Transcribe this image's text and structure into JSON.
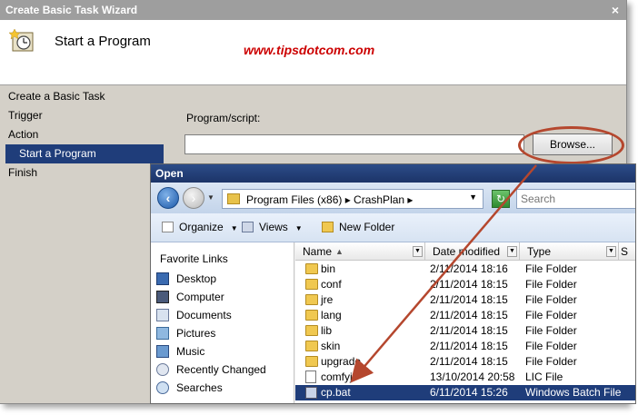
{
  "wizard": {
    "title": "Create Basic Task Wizard",
    "close": "×",
    "page_title": "Start a Program",
    "watermark": "www.tipsdotcom.com",
    "steps": [
      "Create a Basic Task",
      "Trigger",
      "Action",
      "Start a Program",
      "Finish"
    ],
    "active_step": "Start a Program",
    "program_label": "Program/script:",
    "program_value": "",
    "browse_label": "Browse..."
  },
  "open_dialog": {
    "title": "Open",
    "address": "Program Files (x86)  ▸  CrashPlan  ▸",
    "search_placeholder": "Search",
    "toolbar": {
      "organize": "Organize",
      "views": "Views",
      "new_folder": "New Folder"
    },
    "favorites_header": "Favorite Links",
    "favorites": [
      "Desktop",
      "Computer",
      "Documents",
      "Pictures",
      "Music",
      "Recently Changed",
      "Searches"
    ],
    "columns": {
      "name": "Name",
      "date": "Date modified",
      "type": "Type",
      "size": "S"
    },
    "files": [
      {
        "name": "bin",
        "date": "2/11/2014 18:16",
        "type": "File Folder",
        "icon": "folder-icon"
      },
      {
        "name": "conf",
        "date": "2/11/2014 18:15",
        "type": "File Folder",
        "icon": "folder-icon"
      },
      {
        "name": "jre",
        "date": "2/11/2014 18:15",
        "type": "File Folder",
        "icon": "folder-icon"
      },
      {
        "name": "lang",
        "date": "2/11/2014 18:15",
        "type": "File Folder",
        "icon": "folder-icon"
      },
      {
        "name": "lib",
        "date": "2/11/2014 18:15",
        "type": "File Folder",
        "icon": "folder-icon"
      },
      {
        "name": "skin",
        "date": "2/11/2014 18:15",
        "type": "File Folder",
        "icon": "folder-icon"
      },
      {
        "name": "upgrade",
        "date": "2/11/2014 18:15",
        "type": "File Folder",
        "icon": "folder-icon"
      },
      {
        "name": "comfyj",
        "date": "13/10/2014 20:58",
        "type": "LIC File",
        "icon": "document-icon"
      },
      {
        "name": "cp.bat",
        "date": "6/11/2014 15:26",
        "type": "Windows Batch File",
        "icon": "batch-file-icon",
        "selected": true
      }
    ]
  },
  "colors": {
    "accent": "#1f3d7a",
    "annotation": "#b5472e",
    "watermark": "#cc0000"
  }
}
